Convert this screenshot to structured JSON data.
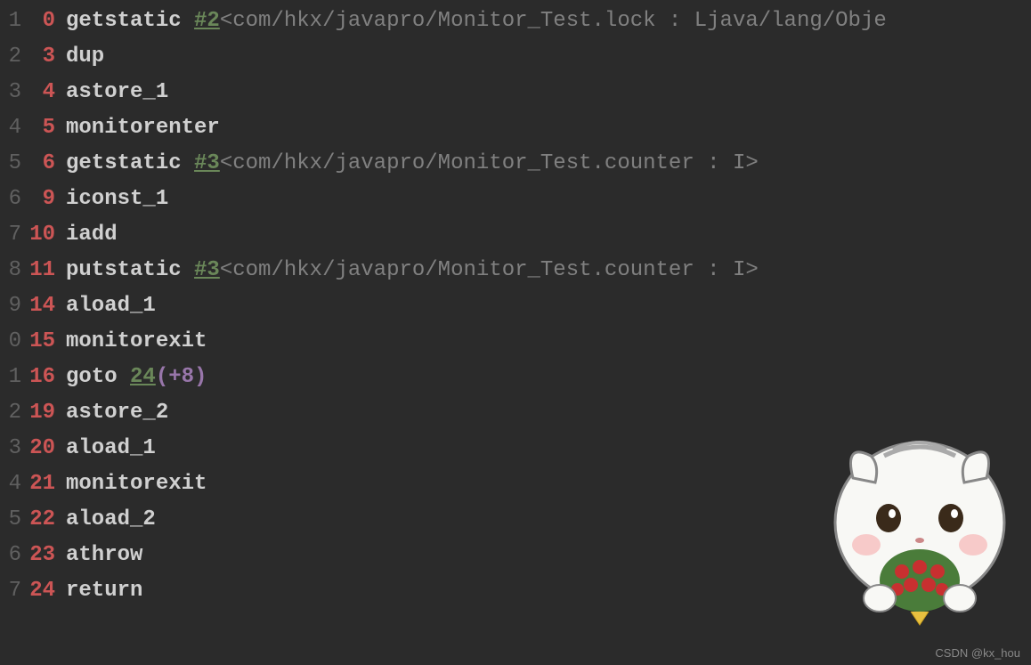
{
  "lines": [
    {
      "lineNum": "1",
      "offset": "0",
      "instr": "getstatic ",
      "constRef": "#2",
      "tail": " <com/hkx/javapro/Monitor_Test.lock : Ljava/lang/Obje"
    },
    {
      "lineNum": "2",
      "offset": "3",
      "instr": "dup"
    },
    {
      "lineNum": "3",
      "offset": "4",
      "instr": "astore_1"
    },
    {
      "lineNum": "4",
      "offset": "5",
      "instr": "monitorenter"
    },
    {
      "lineNum": "5",
      "offset": "6",
      "instr": "getstatic ",
      "constRef": "#3",
      "tail": " <com/hkx/javapro/Monitor_Test.counter : I>"
    },
    {
      "lineNum": "6",
      "offset": "9",
      "instr": "iconst_1"
    },
    {
      "lineNum": "7",
      "offset": "10",
      "instr": "iadd"
    },
    {
      "lineNum": "8",
      "offset": "11",
      "instr": "putstatic ",
      "constRef": "#3",
      "tail": " <com/hkx/javapro/Monitor_Test.counter : I>"
    },
    {
      "lineNum": "9",
      "offset": "14",
      "instr": "aload_1"
    },
    {
      "lineNum": "0",
      "offset": "15",
      "instr": "monitorexit"
    },
    {
      "lineNum": "1",
      "offset": "16",
      "instr": "goto ",
      "gotoTarget": "24",
      "gotoOffset": " (+8)"
    },
    {
      "lineNum": "2",
      "offset": "19",
      "instr": "astore_2"
    },
    {
      "lineNum": "3",
      "offset": "20",
      "instr": "aload_1"
    },
    {
      "lineNum": "4",
      "offset": "21",
      "instr": "monitorexit"
    },
    {
      "lineNum": "5",
      "offset": "22",
      "instr": "aload_2"
    },
    {
      "lineNum": "6",
      "offset": "23",
      "instr": "athrow"
    },
    {
      "lineNum": "7",
      "offset": "24",
      "instr": "return"
    }
  ],
  "watermark": "CSDN @kx_hou"
}
